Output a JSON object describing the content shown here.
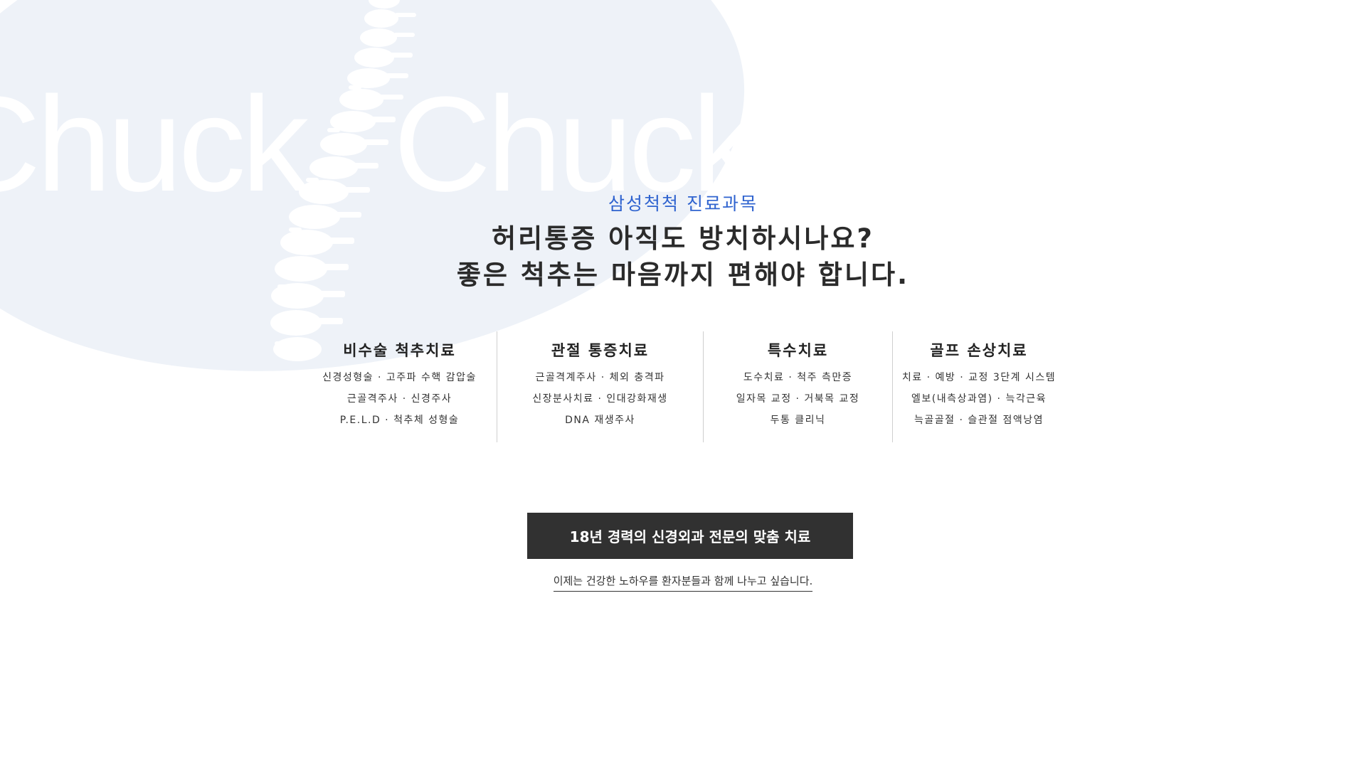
{
  "hero": {
    "watermark_text": "Chuck",
    "background_color": "#eef2f8"
  },
  "section": {
    "eyebrow": "삼성척척 진료과목",
    "headline_line1": "허리통증 아직도 방치하시나요?",
    "headline_line2": "좋은 척추는 마음까지 편해야 합니다.",
    "eyebrow_color": "#2f63cf"
  },
  "services": [
    {
      "title": "비수술 척추치료",
      "lines": [
        "신경성형술 · 고주파 수핵 감압술",
        "근골격주사 · 신경주사",
        "P.E.L.D · 척추체 성형술"
      ]
    },
    {
      "title": "관절 통증치료",
      "lines": [
        "근골격계주사 · 체외 충격파",
        "신장분사치료 · 인대강화재생",
        "DNA 재생주사"
      ]
    },
    {
      "title": "특수치료",
      "lines": [
        "도수치료 · 척주 측만증",
        "일자목 교정 · 거북목 교정",
        "두통 클리닉"
      ]
    },
    {
      "title": "골프 손상치료",
      "lines": [
        "치료 · 예방 · 교정 3단계 시스템",
        "엘보(내측상과염) · 늑각근육",
        "늑골골절 · 슬관절 점액낭염"
      ]
    }
  ],
  "cta": {
    "button_label": "18년 경력의 신경외과 전문의 맞춤 치료",
    "subtext": "이제는 건강한 노하우를 환자분들과 함께 나누고 싶습니다.",
    "button_color": "#313131"
  }
}
